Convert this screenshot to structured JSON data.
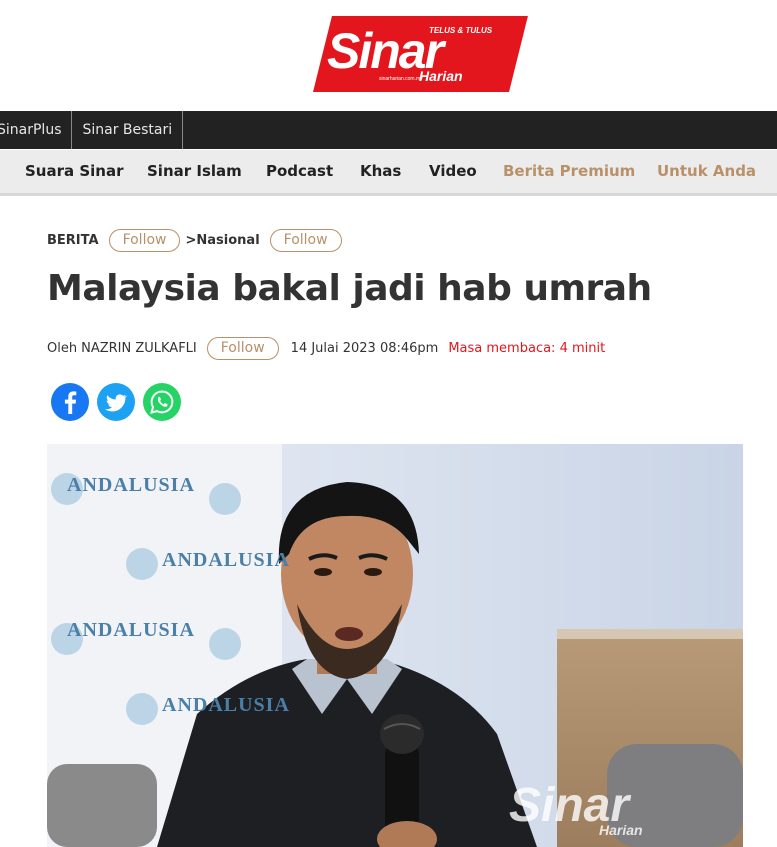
{
  "logo": {
    "brand": "Sinar",
    "tagline": "TELUS & TULUS",
    "sub": "Harian",
    "url": "sinarharian.com.my",
    "color": "#e4161d"
  },
  "top_nav": [
    "SinarPlus",
    "Sinar Bestari"
  ],
  "sub_nav": [
    {
      "label": "Suara Sinar"
    },
    {
      "label": "Sinar Islam"
    },
    {
      "label": "Podcast"
    },
    {
      "label": "Khas"
    },
    {
      "label": "Video"
    },
    {
      "label": "Berita Premium"
    },
    {
      "label": "Untuk Anda"
    }
  ],
  "breadcrumb": {
    "section": "BERITA",
    "separator": ">",
    "subsection": "Nasional",
    "follow_label": "Follow"
  },
  "article": {
    "title": "Malaysia bakal jadi hab umrah",
    "author_prefix": "Oleh",
    "author": "NAZRIN ZULKAFLI",
    "follow_label": "Follow",
    "date": "14 Julai 2023 08:46pm",
    "reading_time": "Masa membaca: 4 minit"
  },
  "social": [
    "facebook-icon",
    "twitter-icon",
    "whatsapp-icon"
  ],
  "photo": {
    "backdrop_word": "ANDALUSIA",
    "watermark": "Sinar",
    "watermark_sub": "Harian"
  },
  "colors": {
    "accent": "#e4161d",
    "premium": "#b8916a",
    "nav_dark": "#222222"
  }
}
